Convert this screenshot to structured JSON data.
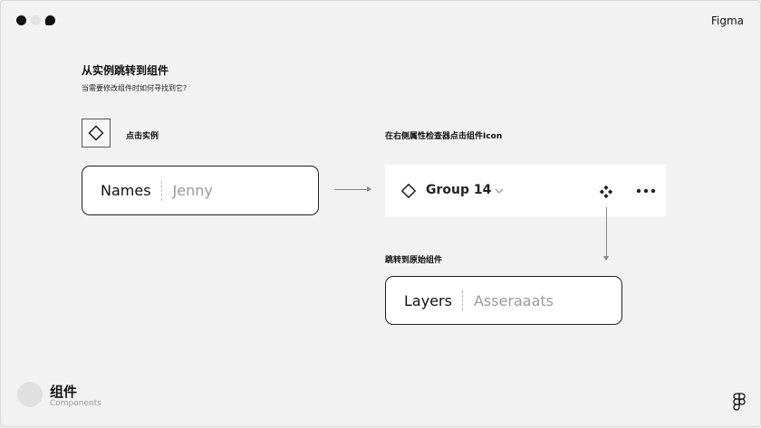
{
  "window": {
    "brand": "Figma"
  },
  "header": {
    "title": "从实例跳转到组件",
    "subtitle": "当需要修改组件时如何寻找到它?"
  },
  "step1": {
    "label": "点击实例",
    "icon": "diamond-instance-icon"
  },
  "names_field": {
    "key": "Names",
    "value": "Jenny"
  },
  "step2": {
    "label": "在右侧属性检查器点击组件Icon"
  },
  "inspector": {
    "layer_name": "Group 14",
    "icons": [
      "diamond-instance-icon",
      "chevron-down-icon",
      "component-icon",
      "more-icon"
    ]
  },
  "step3": {
    "label": "跳转到原始组件"
  },
  "layers_field": {
    "key": "Layers",
    "value": "Asseraaats"
  },
  "footer": {
    "title": "组件",
    "subtitle": "Components",
    "logo": "figma-logo"
  },
  "colors": {
    "background": "#f2f2f2",
    "text": "#111111",
    "muted": "#9a9a9a",
    "card": "#ffffff"
  }
}
